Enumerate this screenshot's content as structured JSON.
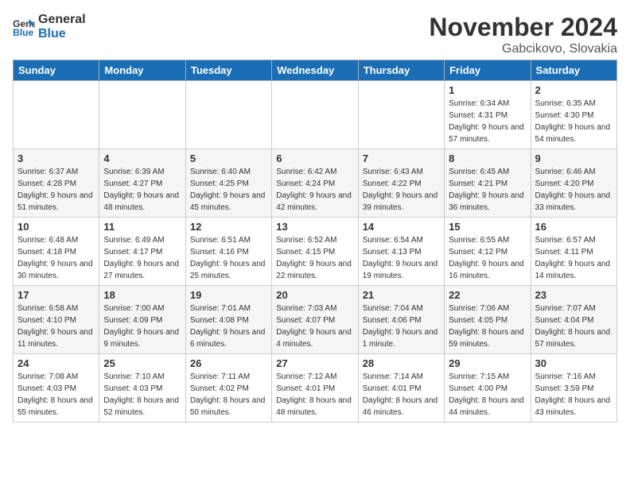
{
  "logo": {
    "line1": "General",
    "line2": "Blue"
  },
  "title": "November 2024",
  "subtitle": "Gabcikovo, Slovakia",
  "days_header": [
    "Sunday",
    "Monday",
    "Tuesday",
    "Wednesday",
    "Thursday",
    "Friday",
    "Saturday"
  ],
  "weeks": [
    [
      {
        "day": "",
        "info": ""
      },
      {
        "day": "",
        "info": ""
      },
      {
        "day": "",
        "info": ""
      },
      {
        "day": "",
        "info": ""
      },
      {
        "day": "",
        "info": ""
      },
      {
        "day": "1",
        "info": "Sunrise: 6:34 AM\nSunset: 4:31 PM\nDaylight: 9 hours and 57 minutes."
      },
      {
        "day": "2",
        "info": "Sunrise: 6:35 AM\nSunset: 4:30 PM\nDaylight: 9 hours and 54 minutes."
      }
    ],
    [
      {
        "day": "3",
        "info": "Sunrise: 6:37 AM\nSunset: 4:28 PM\nDaylight: 9 hours and 51 minutes."
      },
      {
        "day": "4",
        "info": "Sunrise: 6:39 AM\nSunset: 4:27 PM\nDaylight: 9 hours and 48 minutes."
      },
      {
        "day": "5",
        "info": "Sunrise: 6:40 AM\nSunset: 4:25 PM\nDaylight: 9 hours and 45 minutes."
      },
      {
        "day": "6",
        "info": "Sunrise: 6:42 AM\nSunset: 4:24 PM\nDaylight: 9 hours and 42 minutes."
      },
      {
        "day": "7",
        "info": "Sunrise: 6:43 AM\nSunset: 4:22 PM\nDaylight: 9 hours and 39 minutes."
      },
      {
        "day": "8",
        "info": "Sunrise: 6:45 AM\nSunset: 4:21 PM\nDaylight: 9 hours and 36 minutes."
      },
      {
        "day": "9",
        "info": "Sunrise: 6:46 AM\nSunset: 4:20 PM\nDaylight: 9 hours and 33 minutes."
      }
    ],
    [
      {
        "day": "10",
        "info": "Sunrise: 6:48 AM\nSunset: 4:18 PM\nDaylight: 9 hours and 30 minutes."
      },
      {
        "day": "11",
        "info": "Sunrise: 6:49 AM\nSunset: 4:17 PM\nDaylight: 9 hours and 27 minutes."
      },
      {
        "day": "12",
        "info": "Sunrise: 6:51 AM\nSunset: 4:16 PM\nDaylight: 9 hours and 25 minutes."
      },
      {
        "day": "13",
        "info": "Sunrise: 6:52 AM\nSunset: 4:15 PM\nDaylight: 9 hours and 22 minutes."
      },
      {
        "day": "14",
        "info": "Sunrise: 6:54 AM\nSunset: 4:13 PM\nDaylight: 9 hours and 19 minutes."
      },
      {
        "day": "15",
        "info": "Sunrise: 6:55 AM\nSunset: 4:12 PM\nDaylight: 9 hours and 16 minutes."
      },
      {
        "day": "16",
        "info": "Sunrise: 6:57 AM\nSunset: 4:11 PM\nDaylight: 9 hours and 14 minutes."
      }
    ],
    [
      {
        "day": "17",
        "info": "Sunrise: 6:58 AM\nSunset: 4:10 PM\nDaylight: 9 hours and 11 minutes."
      },
      {
        "day": "18",
        "info": "Sunrise: 7:00 AM\nSunset: 4:09 PM\nDaylight: 9 hours and 9 minutes."
      },
      {
        "day": "19",
        "info": "Sunrise: 7:01 AM\nSunset: 4:08 PM\nDaylight: 9 hours and 6 minutes."
      },
      {
        "day": "20",
        "info": "Sunrise: 7:03 AM\nSunset: 4:07 PM\nDaylight: 9 hours and 4 minutes."
      },
      {
        "day": "21",
        "info": "Sunrise: 7:04 AM\nSunset: 4:06 PM\nDaylight: 9 hours and 1 minute."
      },
      {
        "day": "22",
        "info": "Sunrise: 7:06 AM\nSunset: 4:05 PM\nDaylight: 8 hours and 59 minutes."
      },
      {
        "day": "23",
        "info": "Sunrise: 7:07 AM\nSunset: 4:04 PM\nDaylight: 8 hours and 57 minutes."
      }
    ],
    [
      {
        "day": "24",
        "info": "Sunrise: 7:08 AM\nSunset: 4:03 PM\nDaylight: 8 hours and 55 minutes."
      },
      {
        "day": "25",
        "info": "Sunrise: 7:10 AM\nSunset: 4:03 PM\nDaylight: 8 hours and 52 minutes."
      },
      {
        "day": "26",
        "info": "Sunrise: 7:11 AM\nSunset: 4:02 PM\nDaylight: 8 hours and 50 minutes."
      },
      {
        "day": "27",
        "info": "Sunrise: 7:12 AM\nSunset: 4:01 PM\nDaylight: 8 hours and 48 minutes."
      },
      {
        "day": "28",
        "info": "Sunrise: 7:14 AM\nSunset: 4:01 PM\nDaylight: 8 hours and 46 minutes."
      },
      {
        "day": "29",
        "info": "Sunrise: 7:15 AM\nSunset: 4:00 PM\nDaylight: 8 hours and 44 minutes."
      },
      {
        "day": "30",
        "info": "Sunrise: 7:16 AM\nSunset: 3:59 PM\nDaylight: 8 hours and 43 minutes."
      }
    ]
  ]
}
